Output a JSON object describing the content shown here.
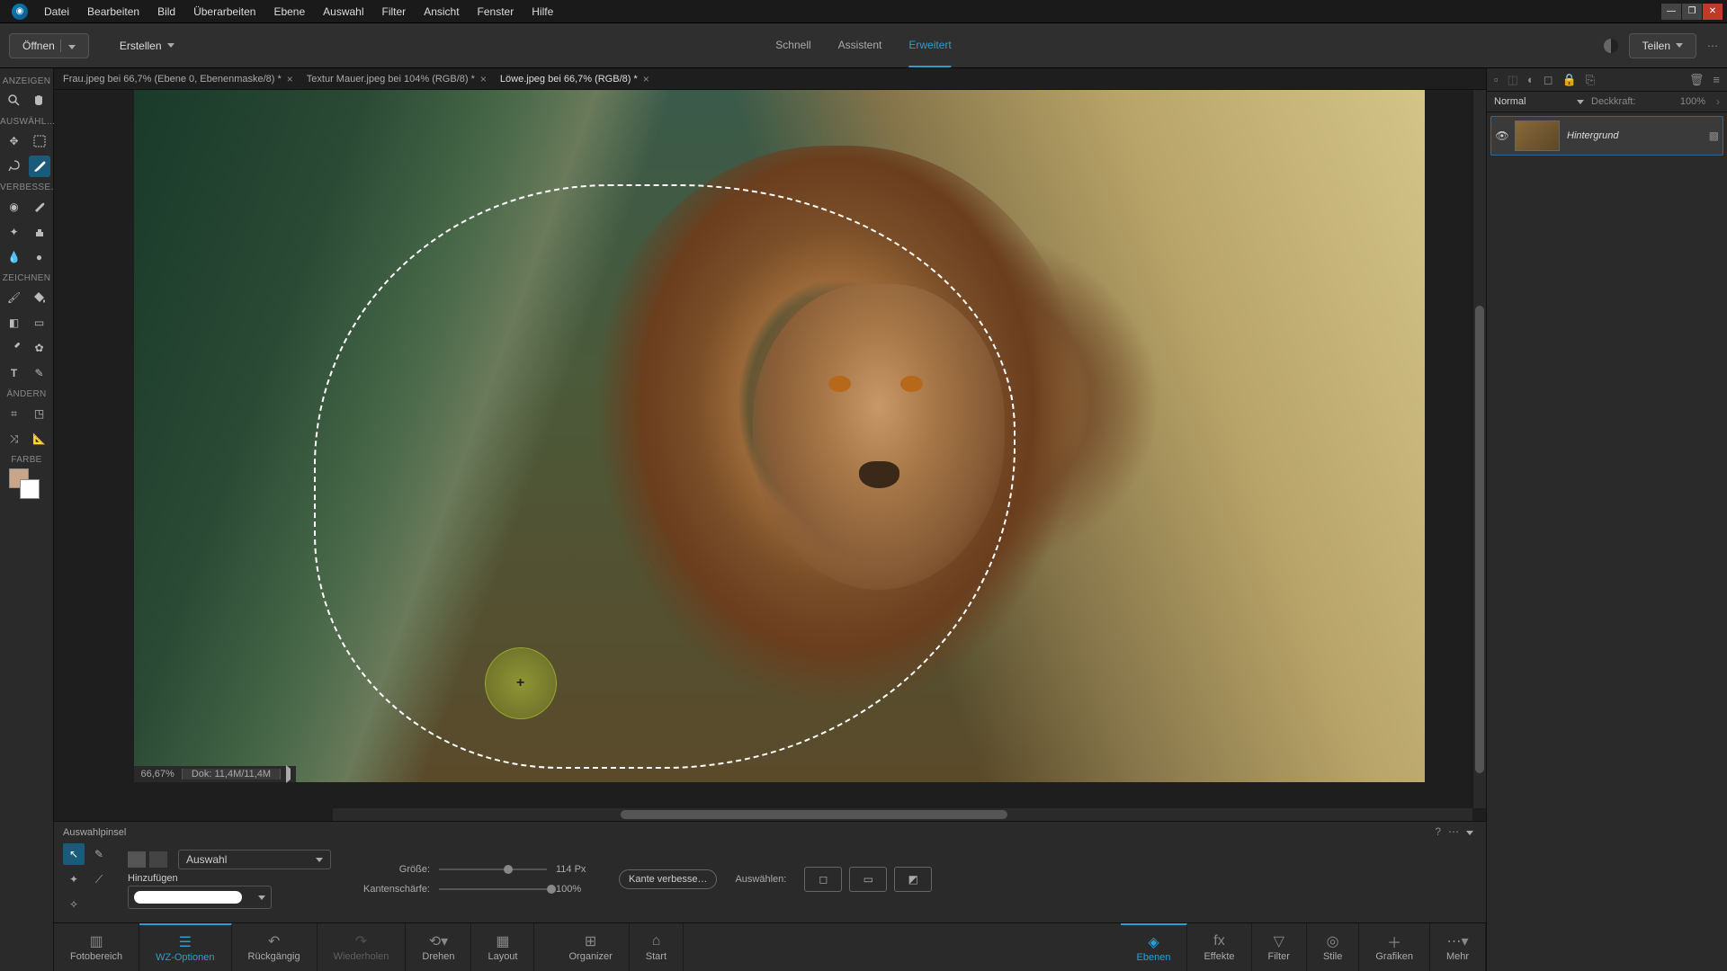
{
  "menubar": {
    "items": [
      "Datei",
      "Bearbeiten",
      "Bild",
      "Überarbeiten",
      "Ebene",
      "Auswahl",
      "Filter",
      "Ansicht",
      "Fenster",
      "Hilfe"
    ]
  },
  "topbar": {
    "open": "Öffnen",
    "create": "Erstellen",
    "modes": {
      "quick": "Schnell",
      "guided": "Assistent",
      "expert": "Erweitert"
    },
    "share": "Teilen"
  },
  "doc_tabs": [
    {
      "label": "Frau.jpeg bei 66,7% (Ebene 0, Ebenenmaske/8) *",
      "active": false
    },
    {
      "label": "Textur Mauer.jpeg bei 104% (RGB/8) *",
      "active": false
    },
    {
      "label": "Löwe.jpeg bei 66,7% (RGB/8) *",
      "active": true
    }
  ],
  "tool_sections": {
    "view": "ANZEIGEN",
    "select": "AUSWÄHL…",
    "enhance": "VERBESSE…",
    "draw": "ZEICHNEN",
    "modify": "ÄNDERN",
    "color": "FARBE"
  },
  "canvas": {
    "zoom": "66,67%",
    "doc_info": "Dok: 11,4M/11,4M"
  },
  "layers": {
    "blend_mode": "Normal",
    "opacity_label": "Deckkraft:",
    "opacity_value": "100%",
    "items": [
      {
        "name": "Hintergrund"
      }
    ]
  },
  "tool_options": {
    "title": "Auswahlpinsel",
    "mode_dropdown": "Auswahl",
    "add_label": "Hinzufügen",
    "size_label": "Größe:",
    "size_value": "114 Px",
    "hardness_label": "Kantenschärfe:",
    "hardness_value": "100%",
    "refine": "Kante verbesse…",
    "select_label": "Auswählen:"
  },
  "bottom_bar": {
    "photo_bin": "Fotobereich",
    "tool_opts": "WZ-Optionen",
    "undo": "Rückgängig",
    "redo": "Wiederholen",
    "rotate": "Drehen",
    "layout": "Layout",
    "organizer": "Organizer",
    "home": "Start",
    "layers": "Ebenen",
    "effects": "Effekte",
    "filter": "Filter",
    "styles": "Stile",
    "graphics": "Grafiken",
    "more": "Mehr"
  }
}
